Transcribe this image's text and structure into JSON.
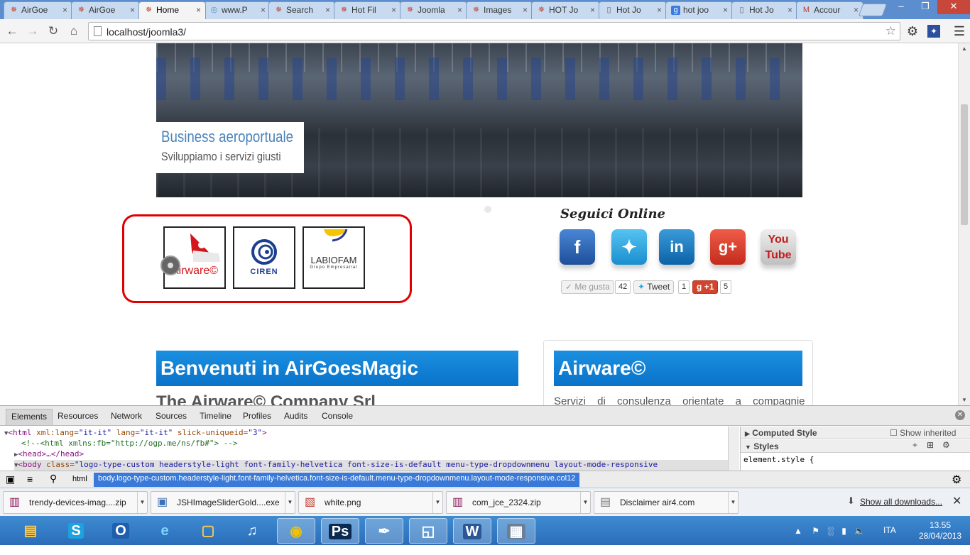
{
  "browser": {
    "tabs": [
      {
        "label": "AirGoe",
        "icon": "joomla-icon"
      },
      {
        "label": "AirGoe",
        "icon": "joomla-icon"
      },
      {
        "label": "Home",
        "icon": "joomla-icon"
      },
      {
        "label": "www.P",
        "icon": "globe-icon"
      },
      {
        "label": "Search",
        "icon": "joomla-icon"
      },
      {
        "label": "Hot Fil",
        "icon": "joomla-icon"
      },
      {
        "label": "Joomla",
        "icon": "joomla-icon"
      },
      {
        "label": "Images",
        "icon": "joomla-icon"
      },
      {
        "label": "HOT Jo",
        "icon": "joomla-icon"
      },
      {
        "label": "Hot Jo",
        "icon": "page-icon"
      },
      {
        "label": "hot joo",
        "icon": "google-icon"
      },
      {
        "label": "Hot Jo",
        "icon": "page-icon"
      },
      {
        "label": "Accour",
        "icon": "gmail-icon"
      }
    ],
    "active_tab": 2,
    "url": "localhost/joomla3/"
  },
  "page": {
    "hero_title": "Business aeroportuale",
    "hero_subtitle": "Sviluppiamo i servizi giusti",
    "partners": [
      {
        "name": "Airware©",
        "color": "#d4161c"
      },
      {
        "name": "CIREN",
        "color": "#1d3f8f"
      },
      {
        "name": "LABIOFAM",
        "sub": "Grupo Empresarial",
        "color": "#333333"
      }
    ],
    "social_title": "Seguici Online",
    "social_icons": [
      "facebook-icon",
      "twitter-icon",
      "linkedin-icon",
      "google-plus-icon",
      "youtube-icon"
    ],
    "social_buttons": {
      "like_label": "Me gusta",
      "like_count": "42",
      "tweet_label": "Tweet",
      "tweet_count": "1",
      "gplus_label": "+1",
      "gplus_count": "5"
    },
    "welcome_heading": "Benvenuti in AirGoesMagic",
    "welcome_subtitle": "The Airware© Company Srl",
    "airware_heading": "Airware©",
    "airware_text": "Servizi di consulenza orientate a compagnie"
  },
  "devtools": {
    "tabs": [
      "Elements",
      "Resources",
      "Network",
      "Sources",
      "Timeline",
      "Profiles",
      "Audits",
      "Console"
    ],
    "dom_lines": [
      {
        "parts": [
          "<html ",
          "xml:lang",
          "=",
          "\"it-it\"",
          " lang",
          "=",
          "\"it-it\"",
          " slick-uniqueid",
          "=",
          "\"3\"",
          ">"
        ]
      },
      {
        "comment": "<!--<html xmlns:fb=\"http://ogp.me/ns/fb#\"> -->"
      },
      {
        "collapsed": "<head>…</head>"
      },
      {
        "body_open": "<body ",
        "body_attr": "class",
        "body_val": "\"logo-type-custom headerstyle-light font-family-helvetica font-size-is-default menu-type-dropdownmenu layout-mode-responsive"
      }
    ],
    "sidebar": {
      "computed_style": "Computed Style",
      "show_inherited": "Show inherited",
      "styles": "Styles",
      "element_style": "element.style {"
    },
    "breadcrumb_html": "html",
    "breadcrumb_body": "body.logo-type-custom.headerstyle-light.font-family-helvetica.font-size-is-default.menu-type-dropdownmenu.layout-mode-responsive.col12"
  },
  "downloads": {
    "items": [
      {
        "name": "trendy-devices-imag....zip",
        "icon": "winrar-icon"
      },
      {
        "name": "JSHImageSliderGold....exe",
        "icon": "installer-icon"
      },
      {
        "name": "white.png",
        "icon": "image-file-icon"
      },
      {
        "name": "com_jce_2324.zip",
        "icon": "winrar-icon"
      },
      {
        "name": "Disclaimer air4.com",
        "icon": "document-icon"
      }
    ],
    "show_all": "Show all downloads..."
  },
  "taskbar": {
    "apps": [
      "explorer-icon",
      "skype-icon",
      "outlook-icon",
      "internet-explorer-icon",
      "folder-icon",
      "itunes-icon",
      "chrome-icon",
      "photoshop-icon",
      "pen-tool-icon",
      "notepad-icon",
      "word-icon",
      "calculator-icon"
    ],
    "language": "ITA",
    "time": "13.55",
    "date": "28/04/2013"
  },
  "colors": {
    "titlebar": "#5c8ecf",
    "accent_blue": "#0a73c9",
    "partners_frame": "#e00000",
    "taskbar": "#2a6db9"
  }
}
